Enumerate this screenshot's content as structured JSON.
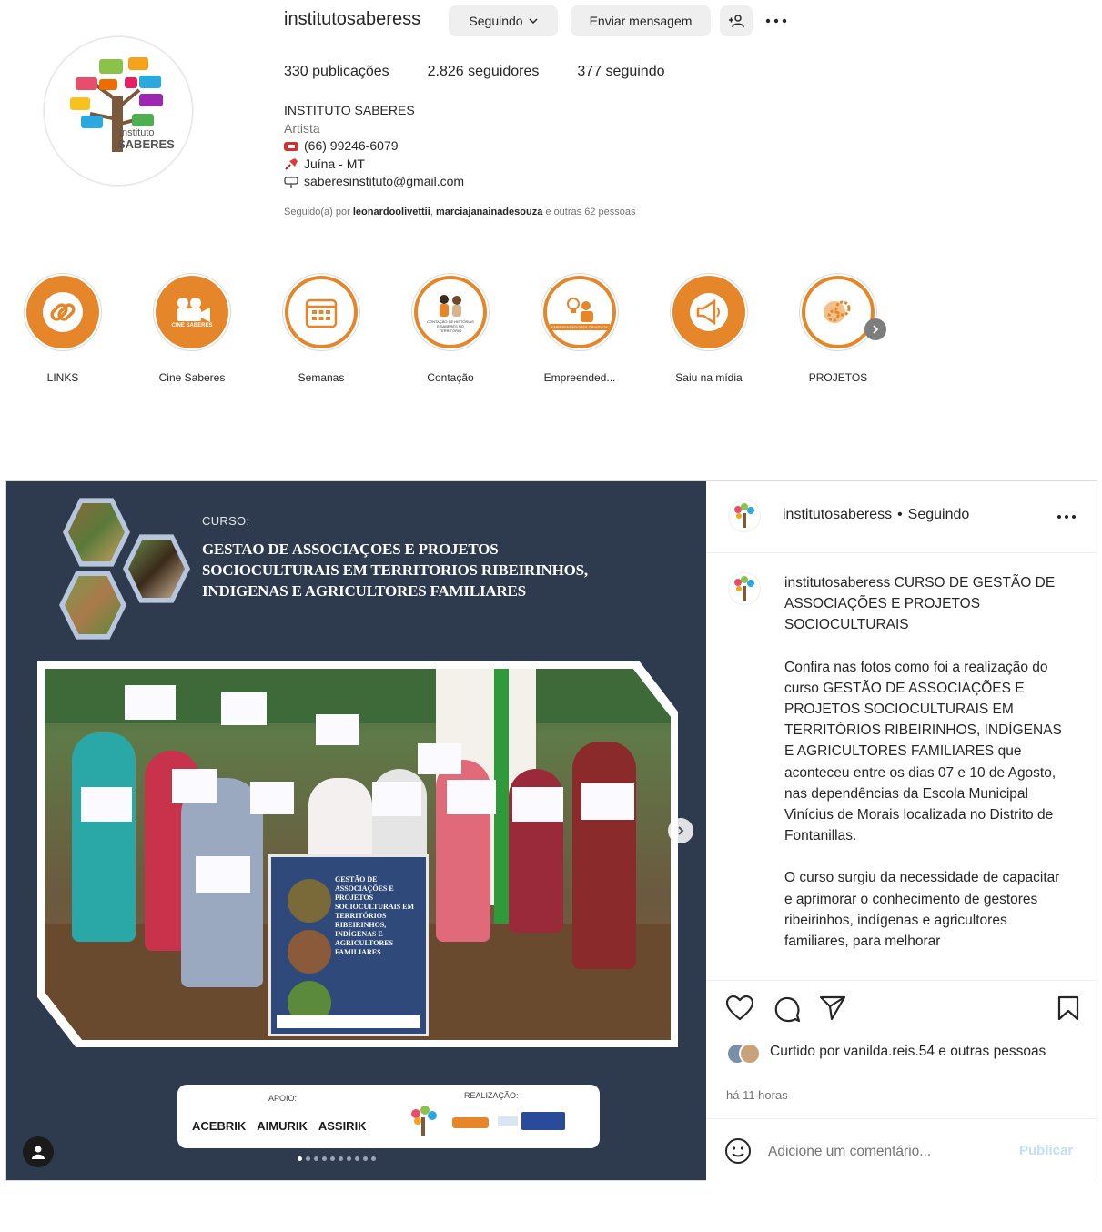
{
  "profile": {
    "username": "institutosaberess",
    "following_btn": "Seguindo",
    "message_btn": "Enviar mensagem",
    "add_person_icon": "add-person-icon",
    "more_icon": "more-icon",
    "avatar_text_1": "Instituto",
    "avatar_text_2": "SABERES",
    "stats": {
      "posts": "330 publicações",
      "followers": "2.826 seguidores",
      "following": "377 seguindo"
    },
    "bio": {
      "name": "INSTITUTO SABERES",
      "category": "Artista",
      "phone": "(66) 99246-6079",
      "location": "Juína - MT",
      "email": "saberesinstituto@gmail.com"
    },
    "followed_by": {
      "prefix": "Seguido(a) por",
      "user1": "leonardoolivettii",
      "sep": ",",
      "user2": "marciajanainadesouza",
      "suffix": "e outras 62 pessoas"
    }
  },
  "highlights": [
    {
      "label": "LINKS",
      "icon": "link-icon"
    },
    {
      "label": "Cine Saberes",
      "icon": "camera-icon",
      "badge": "CINE SABERES"
    },
    {
      "label": "Semanas",
      "icon": "calendar-icon"
    },
    {
      "label": "Contação",
      "icon": "storytelling-icon",
      "badge": "CONTAÇÃO DE HISTÓRIAS E SABERES NO TERRITÓRIO"
    },
    {
      "label": "Empreended...",
      "icon": "idea-icon",
      "badge": "EMPREENDEDORES CRIATIVOS"
    },
    {
      "label": "Saiu na mídia",
      "icon": "megaphone-icon"
    },
    {
      "label": "PROJETOS",
      "icon": "gears-icon"
    }
  ],
  "post": {
    "media": {
      "curso_label": "CURSO:",
      "curso_title": "GESTAO DE ASSOCIAÇOES E PROJETOS SOCIOCULTURAIS EM TERRITORIOS RIBEIRINHOS, INDIGENAS E AGRICULTORES FAMILIARES",
      "banner_text": "GESTÃO DE ASSOCIAÇÕES E PROJETOS SOCIOCULTURAIS EM TERRITÓRIOS RIBEIRINHOS, INDÍGENAS E AGRICULTORES FAMILIARES",
      "apoio": "APOIO:",
      "realizacao": "REALIZAÇÃO:",
      "sponsors": [
        "ACEBRIK",
        "AIMURIK",
        "ASSIRIK"
      ],
      "slide_count": 10,
      "slide_active": 1
    },
    "header": {
      "username": "institutosaberess",
      "dot": "•",
      "status": "Seguindo"
    },
    "caption": {
      "username": "institutosaberess",
      "headline": "CURSO DE GESTÃO DE ASSOCIAÇÕES E PROJETOS SOCIOCULTURAIS",
      "p1": "Confira nas fotos como foi a realização do curso GESTÃO DE ASSOCIAÇÕES E PROJETOS SOCIOCULTURAIS EM TERRITÓRIOS RIBEIRINHOS, INDÍGENAS E AGRICULTORES FAMILIARES que aconteceu entre os dias 07 e 10 de Agosto, nas dependências da Escola Municipal Vinícius de Morais localizada no Distrito de Fontanillas.",
      "p2": "O curso surgiu da necessidade de capacitar e aprimorar o conhecimento de gestores ribeirinhos, indígenas e agricultores familiares, para melhorar"
    },
    "likes": {
      "prefix": "Curtido por",
      "user": "vanilda.reis.54",
      "suffix": "e outras pessoas"
    },
    "time": "há 11 horas",
    "comment_placeholder": "Adicione um comentário...",
    "publish": "Publicar"
  },
  "colors": {
    "accent_orange": "#e6862a",
    "post_bg": "#2e3a4d",
    "publish_disabled": "#c0dffd"
  }
}
